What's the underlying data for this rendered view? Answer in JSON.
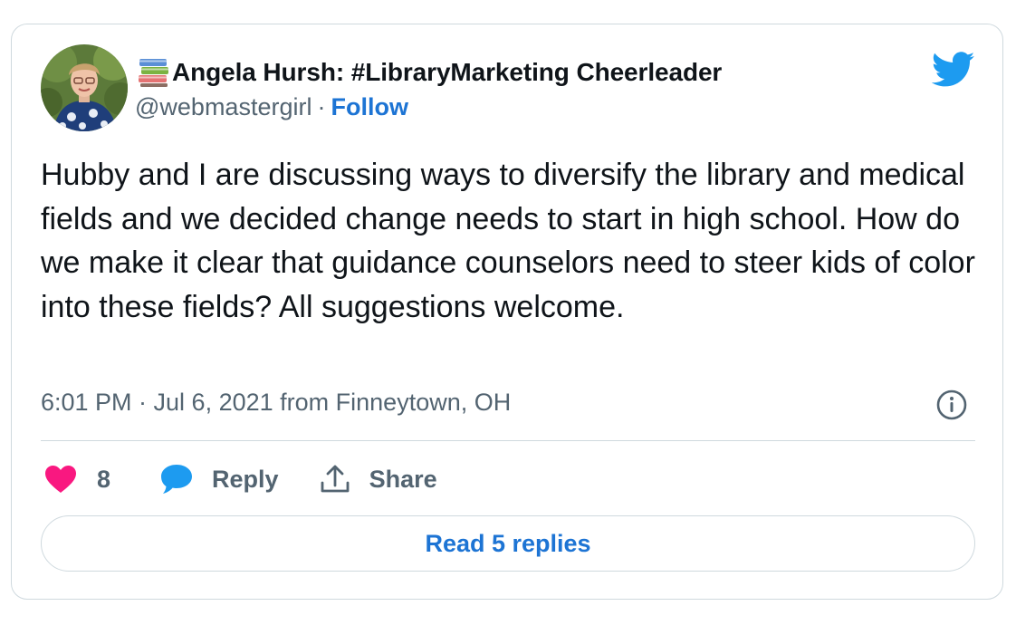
{
  "author": {
    "display_name": "Angela Hursh: #LibraryMarketing Cheerleader",
    "name_emoji": "books-emoji",
    "handle": "@webmastergirl",
    "separator": "·",
    "follow_label": "Follow"
  },
  "tweet": {
    "text": "Hubby and I are discussing ways to diversify the library and medical fields and we decided change needs to start in high school. How do we make it clear that guidance counselors need to steer kids of color into these fields? All suggestions welcome.",
    "timestamp": "6:01 PM · Jul 6, 2021 from Finneytown, OH"
  },
  "actions": {
    "like_count": "8",
    "reply_label": "Reply",
    "share_label": "Share"
  },
  "read_replies_label": "Read 5 replies",
  "icons": {
    "brand": "twitter-bird-icon",
    "info": "info-icon",
    "like": "heart-icon",
    "reply": "speech-bubble-icon",
    "share": "share-upload-icon"
  },
  "colors": {
    "twitter_blue": "#1d9bf0",
    "link_blue": "#1d74d4",
    "heart_pink": "#f91880",
    "text_primary": "#0f1419",
    "text_secondary": "#536471",
    "border": "#cfd9de"
  }
}
